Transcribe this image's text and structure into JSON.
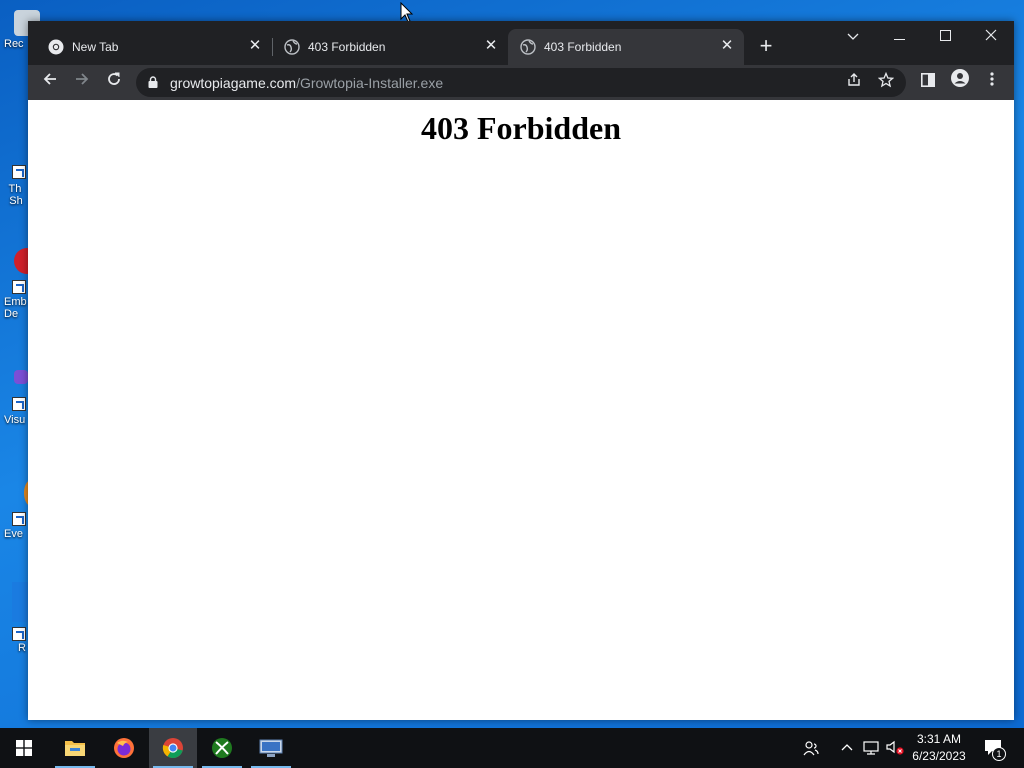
{
  "desktop": {
    "icons": [
      {
        "label": "Rec"
      },
      {
        "label": "Th Sh"
      },
      {
        "label": "Emb De"
      },
      {
        "label": "Visu"
      },
      {
        "label": "Eve"
      },
      {
        "label": "R"
      }
    ]
  },
  "browser": {
    "tabs": [
      {
        "title": "New Tab",
        "active": false
      },
      {
        "title": "403 Forbidden",
        "active": false
      },
      {
        "title": "403 Forbidden",
        "active": true
      }
    ],
    "new_tab_label": "+",
    "address": {
      "host": "growtopiagame.com",
      "path": "/Growtopia-Installer.exe"
    },
    "page": {
      "heading": "403 Forbidden"
    }
  },
  "taskbar": {
    "apps": [
      "start",
      "file-explorer",
      "firefox",
      "chrome",
      "xbox-app",
      "network-app"
    ],
    "clock": {
      "time": "3:31 AM",
      "date": "6/23/2023"
    },
    "notification_count": "1"
  },
  "colors": {
    "desktop": "#0b6fd6",
    "tabstrip": "#202124",
    "toolbar": "#35363a",
    "taskbar": "#0f1114"
  }
}
